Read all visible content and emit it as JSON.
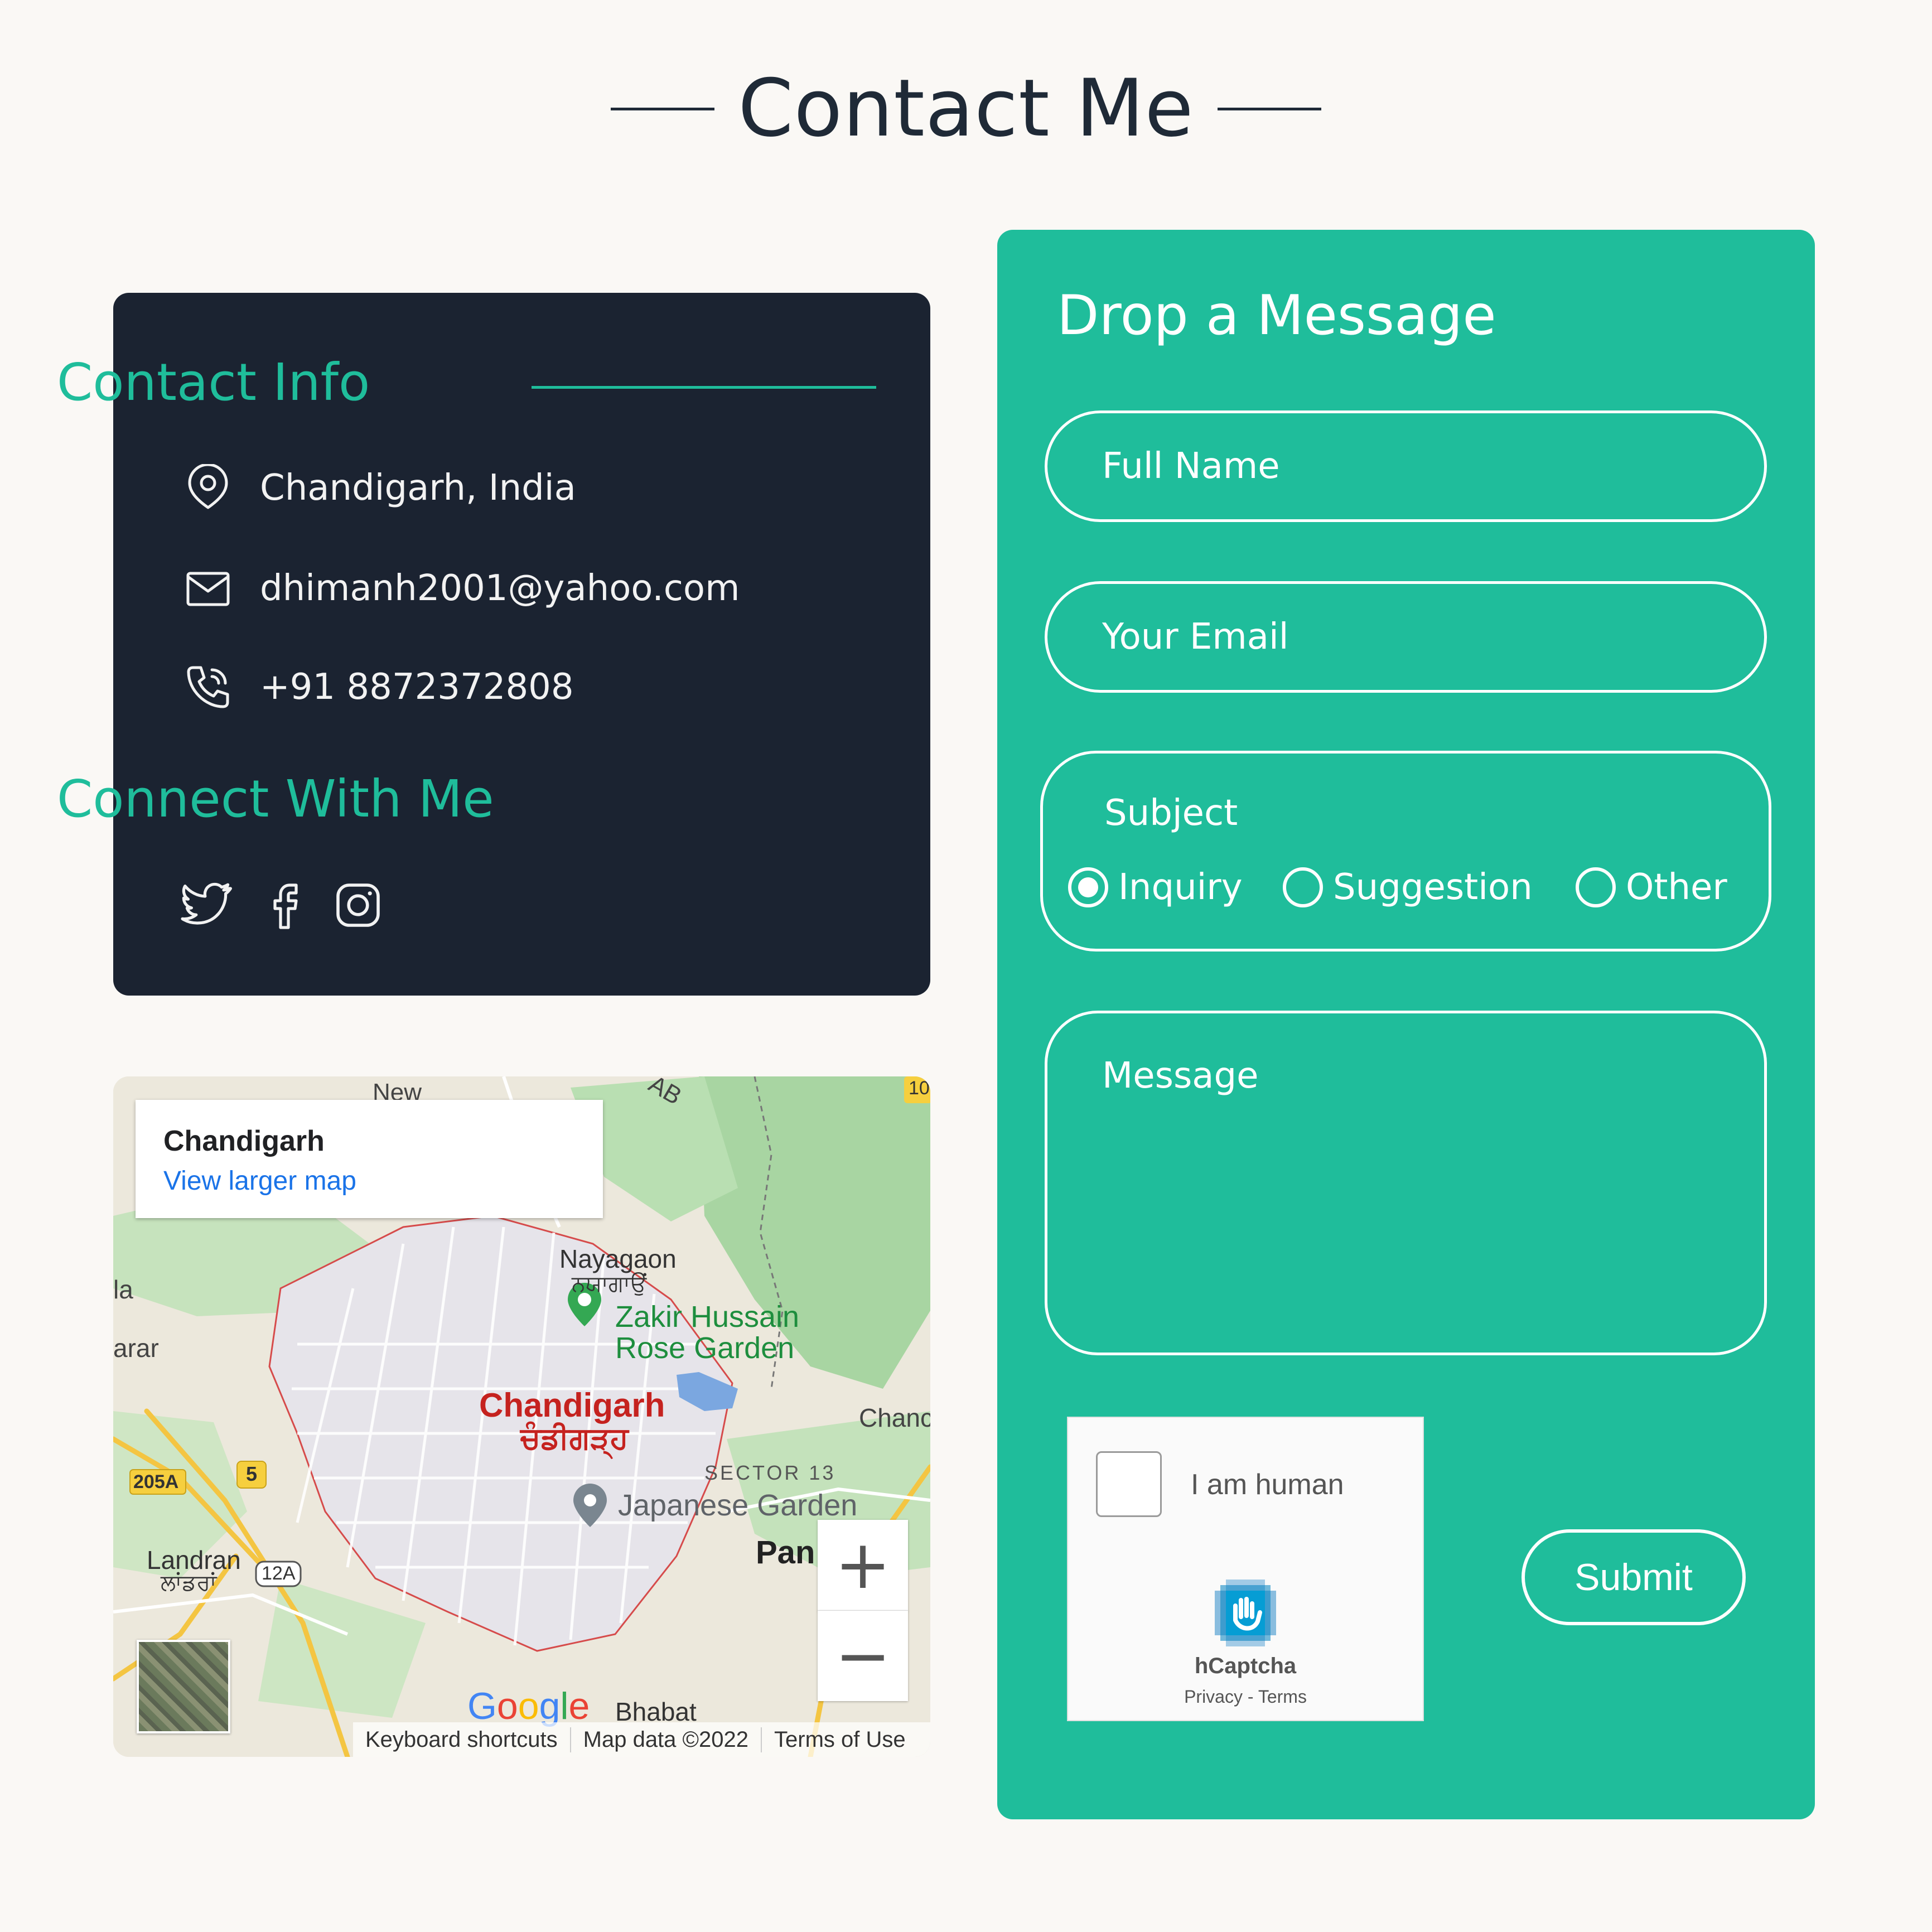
{
  "page": {
    "title": "Contact Me"
  },
  "contact_info": {
    "heading": "Contact Info",
    "items": [
      {
        "icon": "location-pin-icon",
        "text": "Chandigarh, India"
      },
      {
        "icon": "mail-icon",
        "text": "dhimanh2001@yahoo.com"
      },
      {
        "icon": "phone-icon",
        "text": "+91 8872372808"
      }
    ],
    "connect_heading": "Connect With Me",
    "social": [
      {
        "icon": "twitter-icon"
      },
      {
        "icon": "facebook-icon"
      },
      {
        "icon": "instagram-icon"
      }
    ],
    "colors": {
      "card_bg": "#1b2331",
      "accent": "#1fbd9b"
    }
  },
  "map": {
    "place_name": "Chandigarh",
    "larger_map_link": "View larger map",
    "zoom_in": "+",
    "zoom_out": "−",
    "google_logo": "Google",
    "footer": {
      "shortcuts": "Keyboard shortcuts",
      "map_data": "Map data ©2022",
      "terms": "Terms of Use"
    },
    "labels": {
      "city": "Chandigarh",
      "city_local": "ਚੰਡੀਗੜ੍ਹ",
      "nayagaon": "Nayagaon",
      "nayagaon_local": "ਨਯਾਗਾਉਂ",
      "rose_garden_1": "Zakir Hussain",
      "rose_garden_2": "Rose Garden",
      "japanese_garden": "Japanese Garden",
      "sector13": "SECTOR 13",
      "landran": "Landran",
      "landran_local": "ਲਾਂਡਰਾਂ",
      "bhabat": "Bhabat",
      "new": "New",
      "chand_partial": "Chanc",
      "pan_partial": "Pan",
      "route_205a": "205A",
      "route_5": "5",
      "route_12a": "12A",
      "route_10": "10",
      "edge_la": "la",
      "edge_arar": "arar",
      "edge_ab": "AB"
    }
  },
  "form": {
    "title": "Drop a Message",
    "name_placeholder": "Full Name",
    "email_placeholder": "Your Email",
    "subject_label": "Subject",
    "subject_options": [
      {
        "label": "Inquiry",
        "selected": true
      },
      {
        "label": "Suggestion",
        "selected": false
      },
      {
        "label": "Other",
        "selected": false
      }
    ],
    "message_placeholder": "Message",
    "captcha": {
      "label": "I am human",
      "brand": "hCaptcha",
      "links": "Privacy - Terms",
      "checked": false
    },
    "submit_label": "Submit",
    "colors": {
      "card_bg": "#1fbd9b",
      "text": "#ffffff"
    }
  },
  "colors": {
    "page_bg": "#faf8f5",
    "heading": "#1f2a37"
  }
}
